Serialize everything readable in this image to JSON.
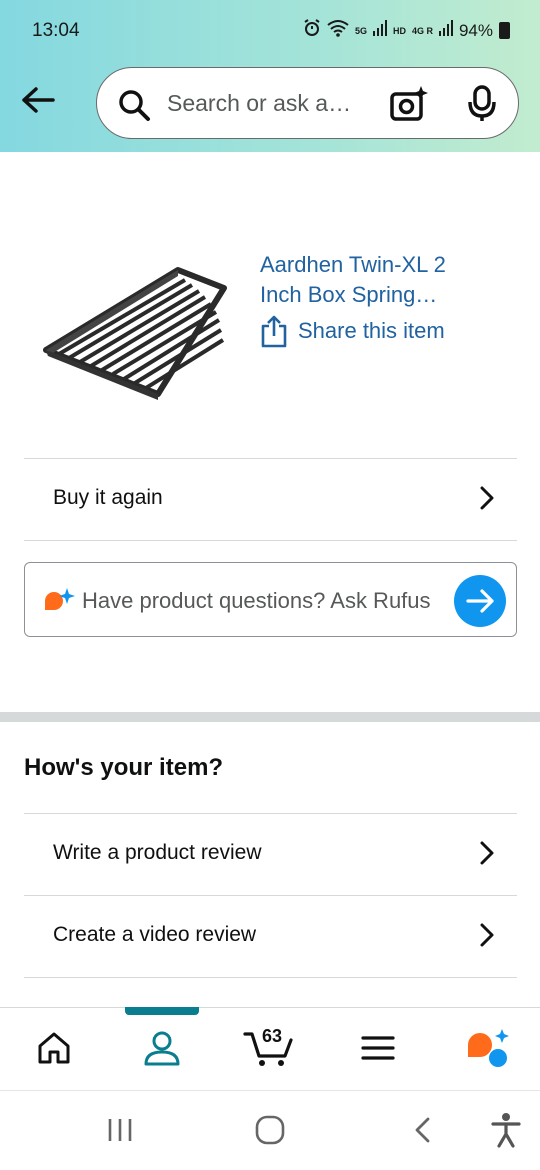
{
  "status": {
    "time": "13:04",
    "network_5g": "5G",
    "hd": "HD",
    "network_4g": "4G R",
    "battery": "94%"
  },
  "header": {
    "search_placeholder": "Search or ask a…"
  },
  "product": {
    "title_line1": "Aardhen Twin-XL 2",
    "title_line2": "Inch Box Spring…",
    "share_label": "Share this item"
  },
  "actions": {
    "buy_again": "Buy it again"
  },
  "rufus": {
    "prompt": "Have product questions? Ask Rufus"
  },
  "review_section": {
    "title": "How's your item?",
    "write_review": "Write a product review",
    "video_review": "Create a video review"
  },
  "bottom_nav": {
    "active_tab": "account",
    "cart_count": "63",
    "accent_color": "#0a7d8f"
  },
  "colors": {
    "link": "#2162a1",
    "rufus_send": "#1196f0",
    "rufus_orange": "#ff6b1a"
  }
}
